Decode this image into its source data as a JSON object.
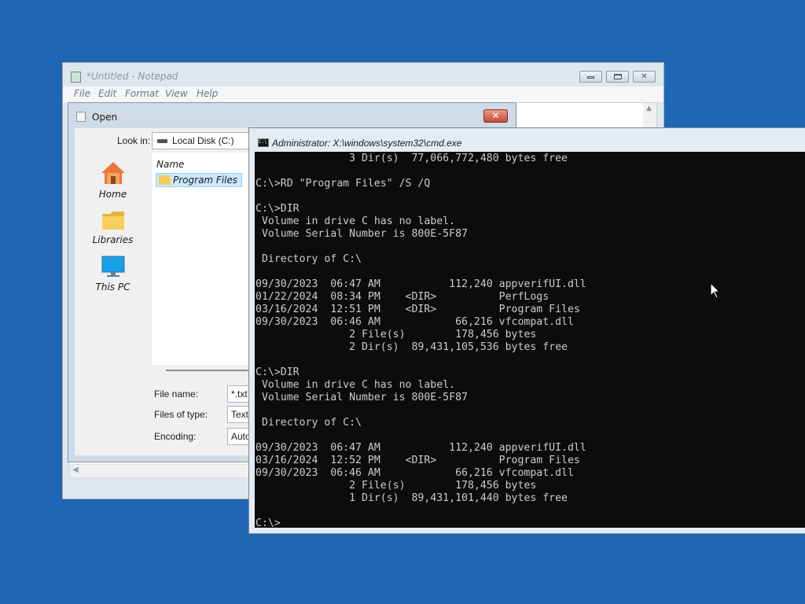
{
  "notepad": {
    "title": "*Untitled - Notepad",
    "menu": [
      "File",
      "Edit",
      "Format",
      "View",
      "Help"
    ],
    "caption_buttons": [
      "minimize",
      "maximize",
      "close"
    ]
  },
  "open_dialog": {
    "title": "Open",
    "close_glyph": "✕",
    "look_in_label": "Look in:",
    "look_in_value": "Local Disk (C:)",
    "places": [
      "Home",
      "Libraries",
      "This PC"
    ],
    "list_header": "Name",
    "items": [
      "Program Files"
    ],
    "file_name_label": "File name:",
    "file_name_value": "*.txt",
    "files_of_type_label": "Files of type:",
    "files_of_type_value": "Text",
    "encoding_label": "Encoding:",
    "encoding_value": "Auto-"
  },
  "cmd": {
    "icon_text": "C:\\",
    "title": "Administrator: X:\\windows\\system32\\cmd.exe",
    "lines": [
      "               3 Dir(s)  77,066,772,480 bytes free",
      "",
      "C:\\>RD \"Program Files\" /S /Q",
      "",
      "C:\\>DIR",
      " Volume in drive C has no label.",
      " Volume Serial Number is 800E-5F87",
      "",
      " Directory of C:\\",
      "",
      "09/30/2023  06:47 AM           112,240 appverifUI.dll",
      "01/22/2024  08:34 PM    <DIR>          PerfLogs",
      "03/16/2024  12:51 PM    <DIR>          Program Files",
      "09/30/2023  06:46 AM            66,216 vfcompat.dll",
      "               2 File(s)        178,456 bytes",
      "               2 Dir(s)  89,431,105,536 bytes free",
      "",
      "C:\\>DIR",
      " Volume in drive C has no label.",
      " Volume Serial Number is 800E-5F87",
      "",
      " Directory of C:\\",
      "",
      "09/30/2023  06:47 AM           112,240 appverifUI.dll",
      "03/16/2024  12:52 PM    <DIR>          Program Files",
      "09/30/2023  06:46 AM            66,216 vfcompat.dll",
      "               2 File(s)        178,456 bytes",
      "               1 Dir(s)  89,431,101,440 bytes free",
      "",
      "C:\\>"
    ]
  },
  "colors": {
    "desktop": "#1f67b5",
    "console_bg": "#0c0c0c",
    "console_fg": "#cccccc",
    "selection": "#cce8ff"
  }
}
